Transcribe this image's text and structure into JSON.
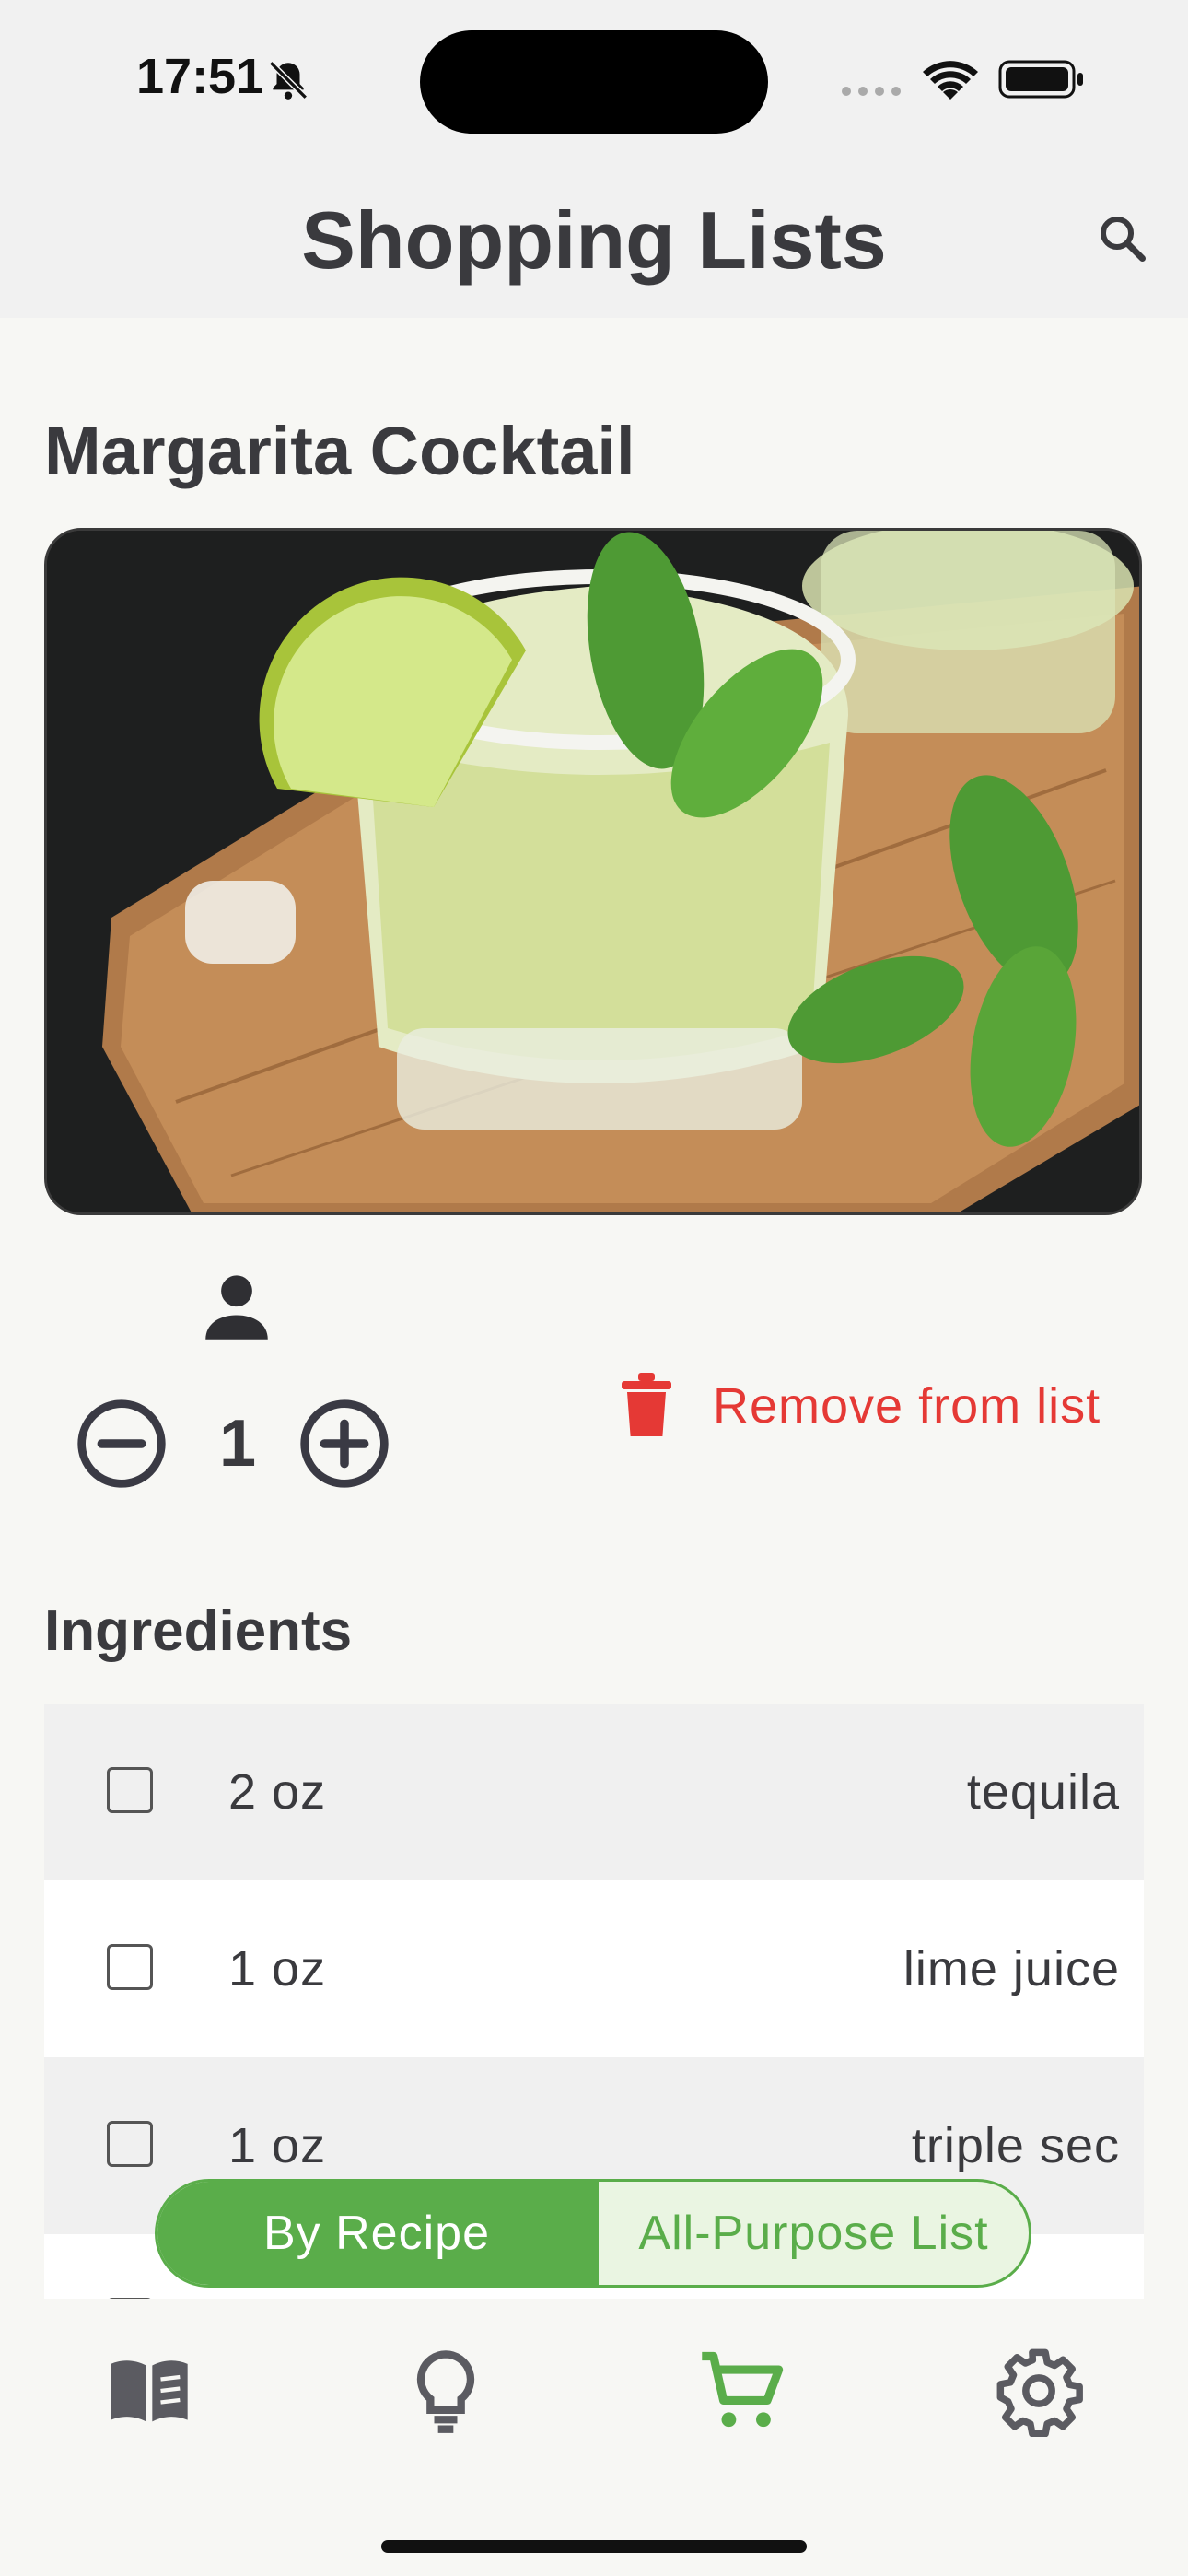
{
  "status_bar": {
    "time": "17:51"
  },
  "header": {
    "title": "Shopping Lists"
  },
  "recipe": {
    "title": "Margarita Cocktail",
    "servings": "1",
    "remove_label": "Remove from list"
  },
  "ingredients": {
    "heading": "Ingredients",
    "items": [
      {
        "qty": "2 oz",
        "name": "tequila",
        "checked": false
      },
      {
        "qty": "1 oz",
        "name": "lime juice",
        "checked": false
      },
      {
        "qty": "1 oz",
        "name": "triple sec",
        "checked": false
      }
    ]
  },
  "segmented": {
    "options": [
      "By Recipe",
      "All-Purpose List"
    ],
    "selected": "By Recipe"
  },
  "tabbar": {
    "items": [
      {
        "icon": "recipe-book-icon",
        "selected": false
      },
      {
        "icon": "lightbulb-icon",
        "selected": false
      },
      {
        "icon": "shopping-cart-icon",
        "selected": true
      },
      {
        "icon": "gear-icon",
        "selected": false
      }
    ]
  },
  "colors": {
    "accent": "#5aad4a",
    "danger": "#e53935",
    "text": "#3a3a3e",
    "background": "#f7f7f4",
    "header_bg": "#f1f1f1"
  }
}
